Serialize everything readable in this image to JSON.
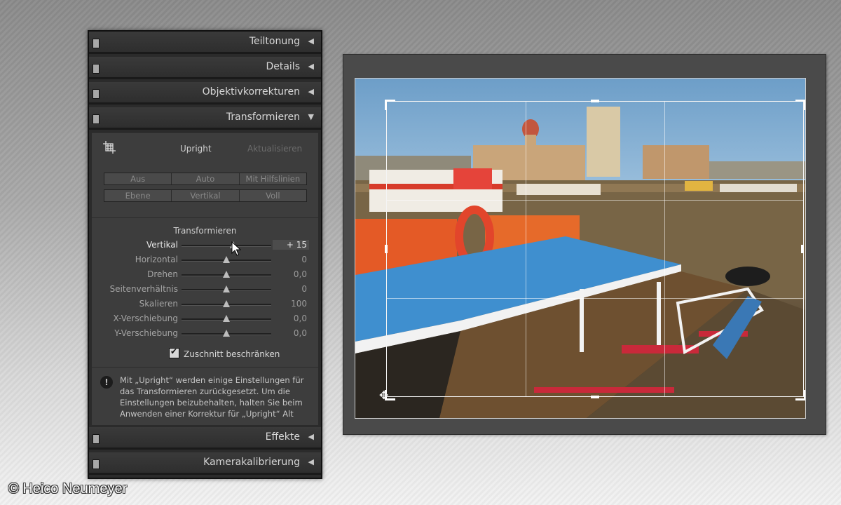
{
  "panel": {
    "sections_top": [
      {
        "label": "Teiltonung",
        "arrow": "◀"
      },
      {
        "label": "Details",
        "arrow": "◀"
      },
      {
        "label": "Objektivkorrekturen",
        "arrow": "◀"
      },
      {
        "label": "Transformieren",
        "arrow": "▼"
      }
    ],
    "upright": {
      "label": "Upright",
      "update_label": "Aktualisieren"
    },
    "mode_row1": [
      "Aus",
      "Auto",
      "Mit Hilfslinien"
    ],
    "mode_row2": [
      "Ebene",
      "Vertikal",
      "Voll"
    ],
    "transform_title": "Transformieren",
    "sliders": [
      {
        "label": "Vertikal",
        "value": "+ 15",
        "level": 0.58
      },
      {
        "label": "Horizontal",
        "value": "0",
        "level": 0.5
      },
      {
        "label": "Drehen",
        "value": "0,0",
        "level": 0.5
      },
      {
        "label": "Seitenverhältnis",
        "value": "0",
        "level": 0.5
      },
      {
        "label": "Skalieren",
        "value": "100",
        "level": 0.5
      },
      {
        "label": "X-Verschiebung",
        "value": "0,0",
        "level": 0.5
      },
      {
        "label": "Y-Verschiebung",
        "value": "0,0",
        "level": 0.5
      }
    ],
    "constrain_crop": {
      "label": "Zuschnitt beschränken",
      "checked": true
    },
    "info_text": "Mit „Upright“ werden einige Einstellungen für das Transformieren zurückgesetzt. Um die Einstellungen beizubehalten, halten Sie beim Anwenden einer Korrektur für „Upright“ Alt",
    "sections_bottom": [
      {
        "label": "Effekte",
        "arrow": "◀"
      },
      {
        "label": "Kamerakalibrierung",
        "arrow": "◀"
      }
    ]
  },
  "credit": "© Heico Neumeyer",
  "icons": {
    "crop_tool": "crop-grid-icon",
    "info": "exclamation-icon",
    "rotate": "rotate-crop-icon",
    "cursor": "mouse-pointer-icon"
  }
}
